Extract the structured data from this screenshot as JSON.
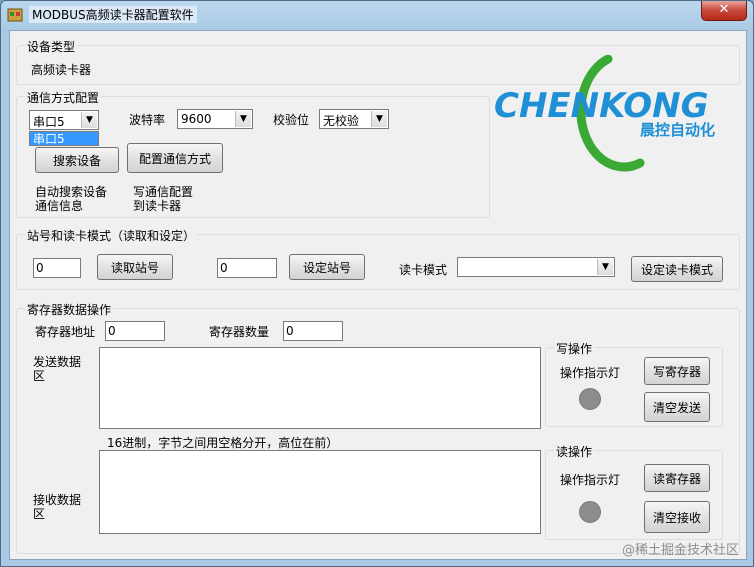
{
  "window": {
    "title": "MODBUS高频读卡器配置软件",
    "close_glyph": "✕"
  },
  "device_type": {
    "group_title": "设备类型",
    "value": "高频读卡器"
  },
  "comm": {
    "group_title": "通信方式配置",
    "port_value": "串口5",
    "port_dropdown_item": "串口5",
    "baud_label": "波特率",
    "baud_value": "9600",
    "parity_label": "校验位",
    "parity_value": "无校验",
    "search_button": "搜索设备",
    "config_button": "配置通信方式",
    "search_desc_line1": "自动搜索设备",
    "search_desc_line2": "通信信息",
    "config_desc_line1": "写通信配置",
    "config_desc_line2": "到读卡器"
  },
  "logo": {
    "brand": "CHENKONG",
    "subtitle": "晨控自动化"
  },
  "station": {
    "group_title": "站号和读卡模式（读取和设定）",
    "read_input": "0",
    "read_button": "读取站号",
    "set_input": "0",
    "set_button": "设定站号",
    "mode_label": "读卡模式",
    "mode_value": "",
    "set_mode_button": "设定读卡模式"
  },
  "register": {
    "group_title": "寄存器数据操作",
    "addr_label": "寄存器地址",
    "addr_value": "0",
    "count_label": "寄存器数量",
    "count_value": "0",
    "send_label_line1": "发送数据",
    "send_label_line2": "区",
    "hex_hint": "16进制，字节之间用空格分开，高位在前）",
    "recv_label_line1": "接收数据",
    "recv_label_line2": "区",
    "write_group": "写操作",
    "write_led_label": "操作指示灯",
    "write_button": "写寄存器",
    "clear_send_button": "清空发送",
    "read_group": "读操作",
    "read_led_label": "操作指示灯",
    "read_button": "读寄存器",
    "clear_recv_button": "清空接收"
  },
  "watermark": "@稀土掘金技术社区",
  "colors": {
    "logo_blue": "#1f8fd6",
    "logo_green": "#3aaa35",
    "led_off": "#8c8c8c"
  }
}
